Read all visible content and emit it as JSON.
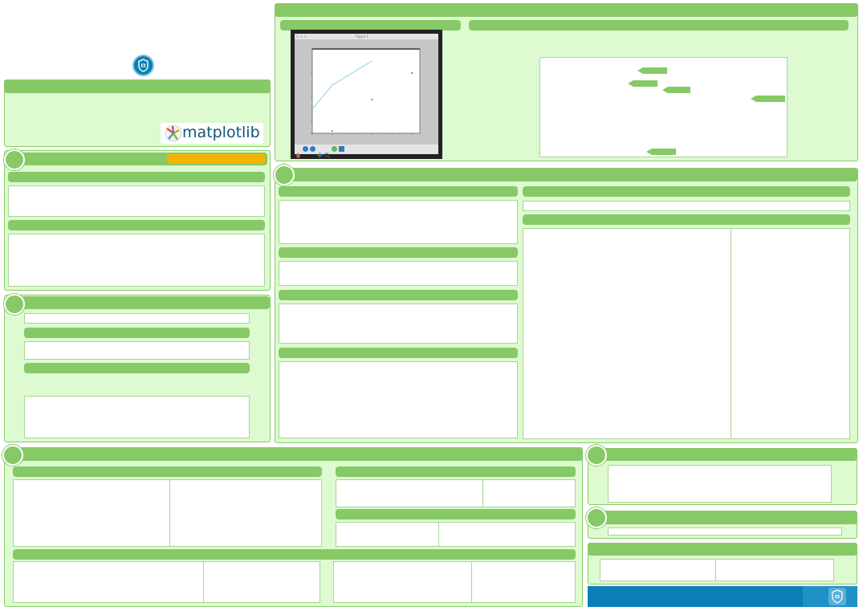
{
  "brand": {
    "library_name": "matplotlib",
    "accent_color": "#86c966",
    "highlight_color": "#f5b400",
    "footer_color": "#0c7fb6",
    "badge_icon": "cheatsheet-badge-icon"
  },
  "figure_window": {
    "title": "Figure 1",
    "toolbar_icons": [
      "home-icon",
      "back-arrow-icon",
      "forward-arrow-icon",
      "pan-icon",
      "zoom-icon",
      "configure-icon",
      "save-icon"
    ]
  },
  "chart_data": {
    "type": "line",
    "title": "",
    "xlabel": "",
    "ylabel": "",
    "line_series": {
      "x": [
        0,
        1,
        3
      ],
      "y": [
        10,
        20,
        30
      ]
    },
    "scatter_points": [
      {
        "x": 1,
        "y": 1
      },
      {
        "x": 3,
        "y": 14
      },
      {
        "x": 5,
        "y": 25
      }
    ],
    "xlim": [
      0,
      5.4
    ],
    "ylim": [
      0,
      35
    ],
    "grid": false
  }
}
